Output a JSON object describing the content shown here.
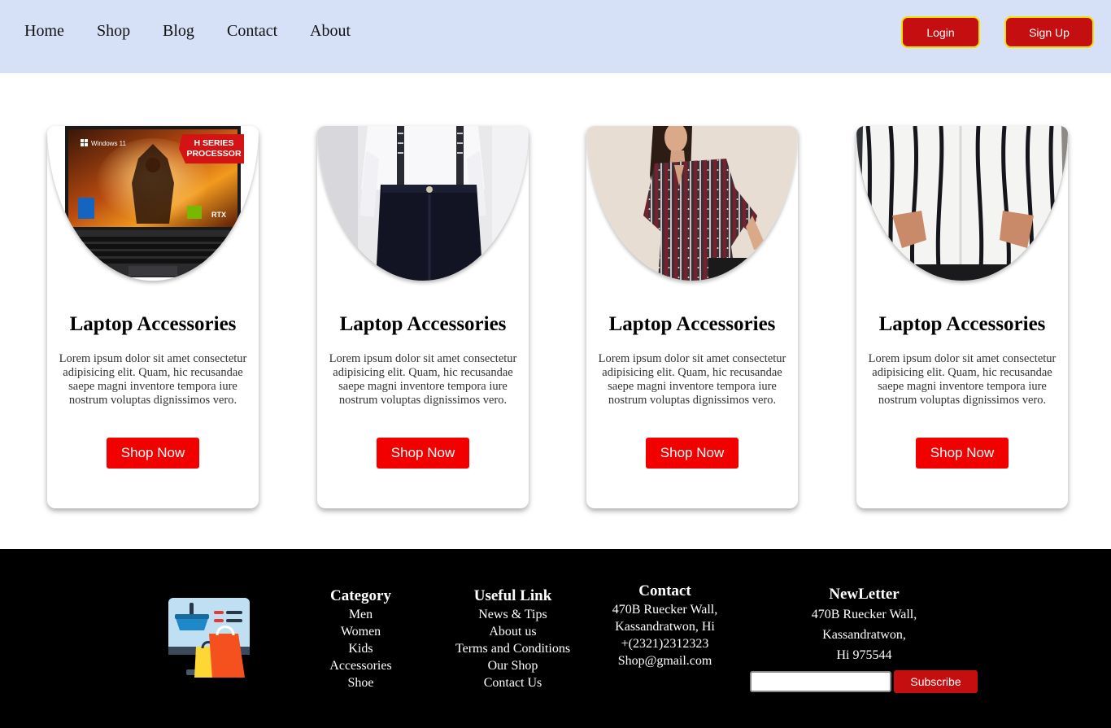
{
  "nav": {
    "links": [
      "Home",
      "Shop",
      "Blog",
      "Contact",
      "About"
    ],
    "login": "Login",
    "signup": "Sign Up"
  },
  "colors": {
    "header_bg": "#d6e0f7",
    "auth_button": "#c40e10",
    "auth_border": "#f2e000",
    "shop_button": "#f20000",
    "footer_bg": "#000000"
  },
  "cards": [
    {
      "image": "laptop-product-photo",
      "image_badge": "H SERIES PROCESSOR",
      "image_os": "Windows 11",
      "image_gpu": "RTX",
      "title": "Laptop Accessories",
      "description": "Lorem ipsum dolor sit amet consectetur adipisicing elit. Quam, hic recusandae saepe magni inventore tempora iure nostrum voluptas dignissimos vero.",
      "button": "Shop Now"
    },
    {
      "image": "mens-suspenders-outfit-photo",
      "title": "Laptop Accessories",
      "description": "Lorem ipsum dolor sit amet consectetur adipisicing elit. Quam, hic recusandae saepe magni inventore tempora iure nostrum voluptas dignissimos vero.",
      "button": "Shop Now"
    },
    {
      "image": "womens-printed-top-photo",
      "title": "Laptop Accessories",
      "description": "Lorem ipsum dolor sit amet consectetur adipisicing elit. Quam, hic recusandae saepe magni inventore tempora iure nostrum voluptas dignissimos vero.",
      "button": "Shop Now"
    },
    {
      "image": "striped-shirt-photo",
      "title": "Laptop Accessories",
      "description": "Lorem ipsum dolor sit amet consectetur adipisicing elit. Quam, hic recusandae saepe magni inventore tempora iure nostrum voluptas dignissimos vero.",
      "button": "Shop Now"
    }
  ],
  "footer": {
    "logo_icon": "shopping-cart-monitor-icon",
    "category": {
      "title": "Category",
      "items": [
        "Men",
        "Women",
        "Kids",
        "Accessories",
        "Shoe"
      ]
    },
    "useful": {
      "title": "Useful Link",
      "items": [
        "News & Tips",
        "About us",
        "Terms and Conditions",
        "Our Shop",
        "Contact Us"
      ]
    },
    "contact": {
      "title": "Contact",
      "lines": [
        "470B Ruecker Wall,",
        "Kassandratwon, Hi",
        "+(2321)2312323",
        "Shop@gmail.com"
      ]
    },
    "newsletter": {
      "title": "NewLetter",
      "lines": [
        "470B Ruecker Wall,",
        "Kassandratwon,",
        "Hi 975544"
      ],
      "input_value": "",
      "button": "Subscribe"
    }
  }
}
